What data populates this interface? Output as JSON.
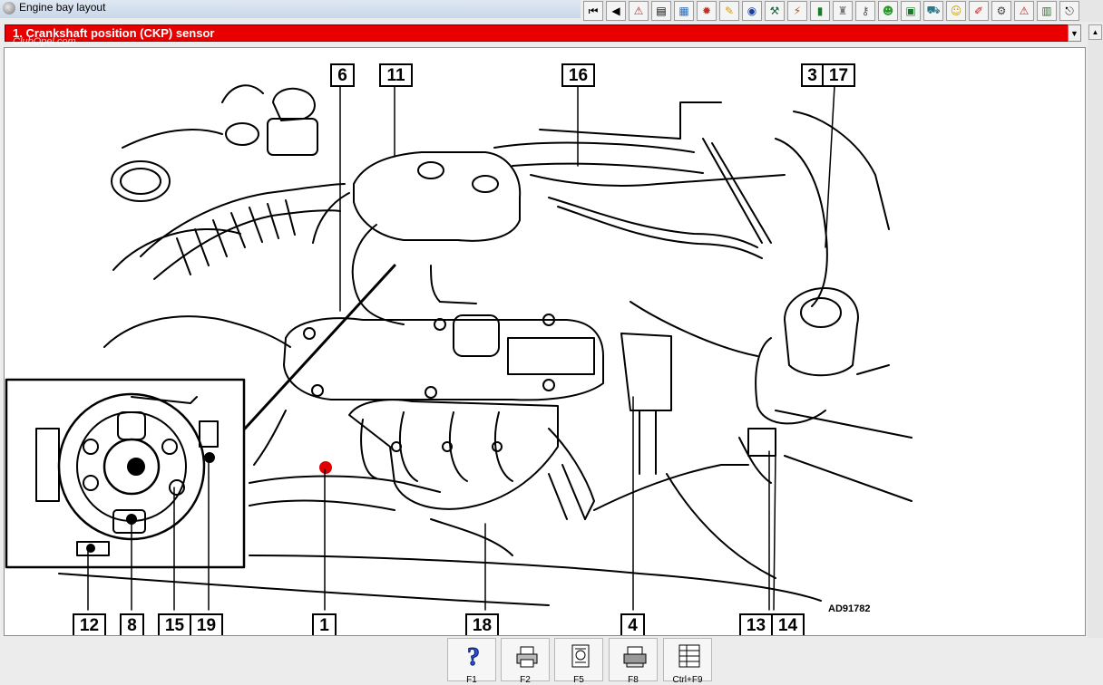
{
  "window": {
    "title": "Engine bay layout"
  },
  "selector": {
    "selected": "1.   Crankshaft position (CKP) sensor"
  },
  "watermark": "ClubOpel.com",
  "diagram": {
    "code": "AD91782",
    "callouts": [
      "6",
      "11",
      "16",
      "3",
      "17",
      "12",
      "8",
      "15",
      "19",
      "1",
      "18",
      "4",
      "13",
      "14"
    ]
  },
  "toolbar": {
    "icons": [
      "first-page-icon",
      "previous-page-icon",
      "warning-icon",
      "document-icon",
      "map-icon",
      "engine-icon",
      "wrench-icon",
      "circle-gauge-icon",
      "tools-icon",
      "electrical-icon",
      "door-icon",
      "seat-icon",
      "key-icon",
      "bulb-icon",
      "panel-icon",
      "car-icon",
      "smiley-icon",
      "pencil-icon",
      "gear-icon",
      "warning-sign-icon",
      "chart-icon",
      "exit-icon"
    ]
  },
  "footer": {
    "keys": [
      {
        "label": "F1",
        "icon": "help-icon"
      },
      {
        "label": "F2",
        "icon": "printer-icon"
      },
      {
        "label": "F5",
        "icon": "zoom-page-icon"
      },
      {
        "label": "F8",
        "icon": "print-all-icon"
      },
      {
        "label": "Ctrl+F9",
        "icon": "table-icon"
      }
    ]
  }
}
